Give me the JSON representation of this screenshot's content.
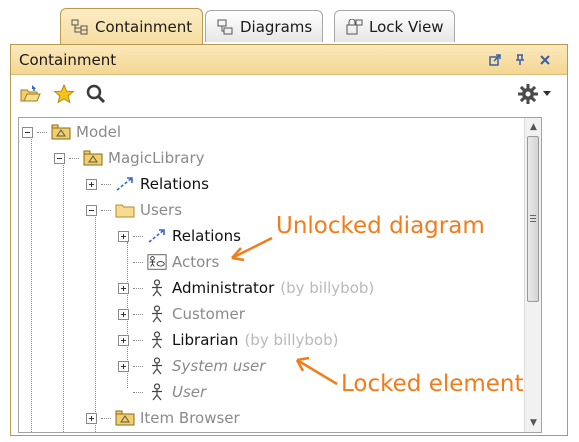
{
  "tabs": [
    {
      "label": "Containment",
      "icon": "containment-icon"
    },
    {
      "label": "Diagrams",
      "icon": "diagrams-icon"
    },
    {
      "label": "Lock View",
      "icon": "lock-view-icon"
    }
  ],
  "panel": {
    "title": "Containment",
    "controls": [
      "undock-icon",
      "pin-icon",
      "close-icon"
    ]
  },
  "toolbar": {
    "icons": [
      "open-folder-icon",
      "star-icon",
      "search-icon",
      "gear-icon",
      "dropdown-arrow-icon"
    ]
  },
  "tree": [
    {
      "label": "Model",
      "owner": "",
      "icon": "package-icon",
      "style": "gray"
    },
    {
      "label": "MagicLibrary",
      "owner": "",
      "icon": "package-icon",
      "style": "gray"
    },
    {
      "label": "Relations",
      "owner": "",
      "icon": "relations-icon",
      "style": "dark"
    },
    {
      "label": "Users",
      "owner": "",
      "icon": "folder-icon",
      "style": "gray"
    },
    {
      "label": "Relations",
      "owner": "",
      "icon": "relations-icon",
      "style": "dark"
    },
    {
      "label": "Actors",
      "owner": "",
      "icon": "diagram-icon",
      "style": "gray"
    },
    {
      "label": "Administrator",
      "owner": "(by billybob)",
      "icon": "actor-icon",
      "style": "dark"
    },
    {
      "label": "Customer",
      "owner": "",
      "icon": "actor-icon",
      "style": "gray"
    },
    {
      "label": "Librarian",
      "owner": "(by billybob)",
      "icon": "actor-icon",
      "style": "dark"
    },
    {
      "label": "System user",
      "owner": "",
      "icon": "actor-icon",
      "style": "gray-italic"
    },
    {
      "label": "User",
      "owner": "",
      "icon": "actor-icon",
      "style": "gray-italic"
    },
    {
      "label": "Item Browser",
      "owner": "",
      "icon": "package-icon",
      "style": "gray"
    }
  ],
  "callouts": {
    "unlocked": "Unlocked diagram",
    "locked": "Locked element"
  },
  "colors": {
    "accent": "#f07d1b",
    "panel_header": "#f6dca0"
  }
}
